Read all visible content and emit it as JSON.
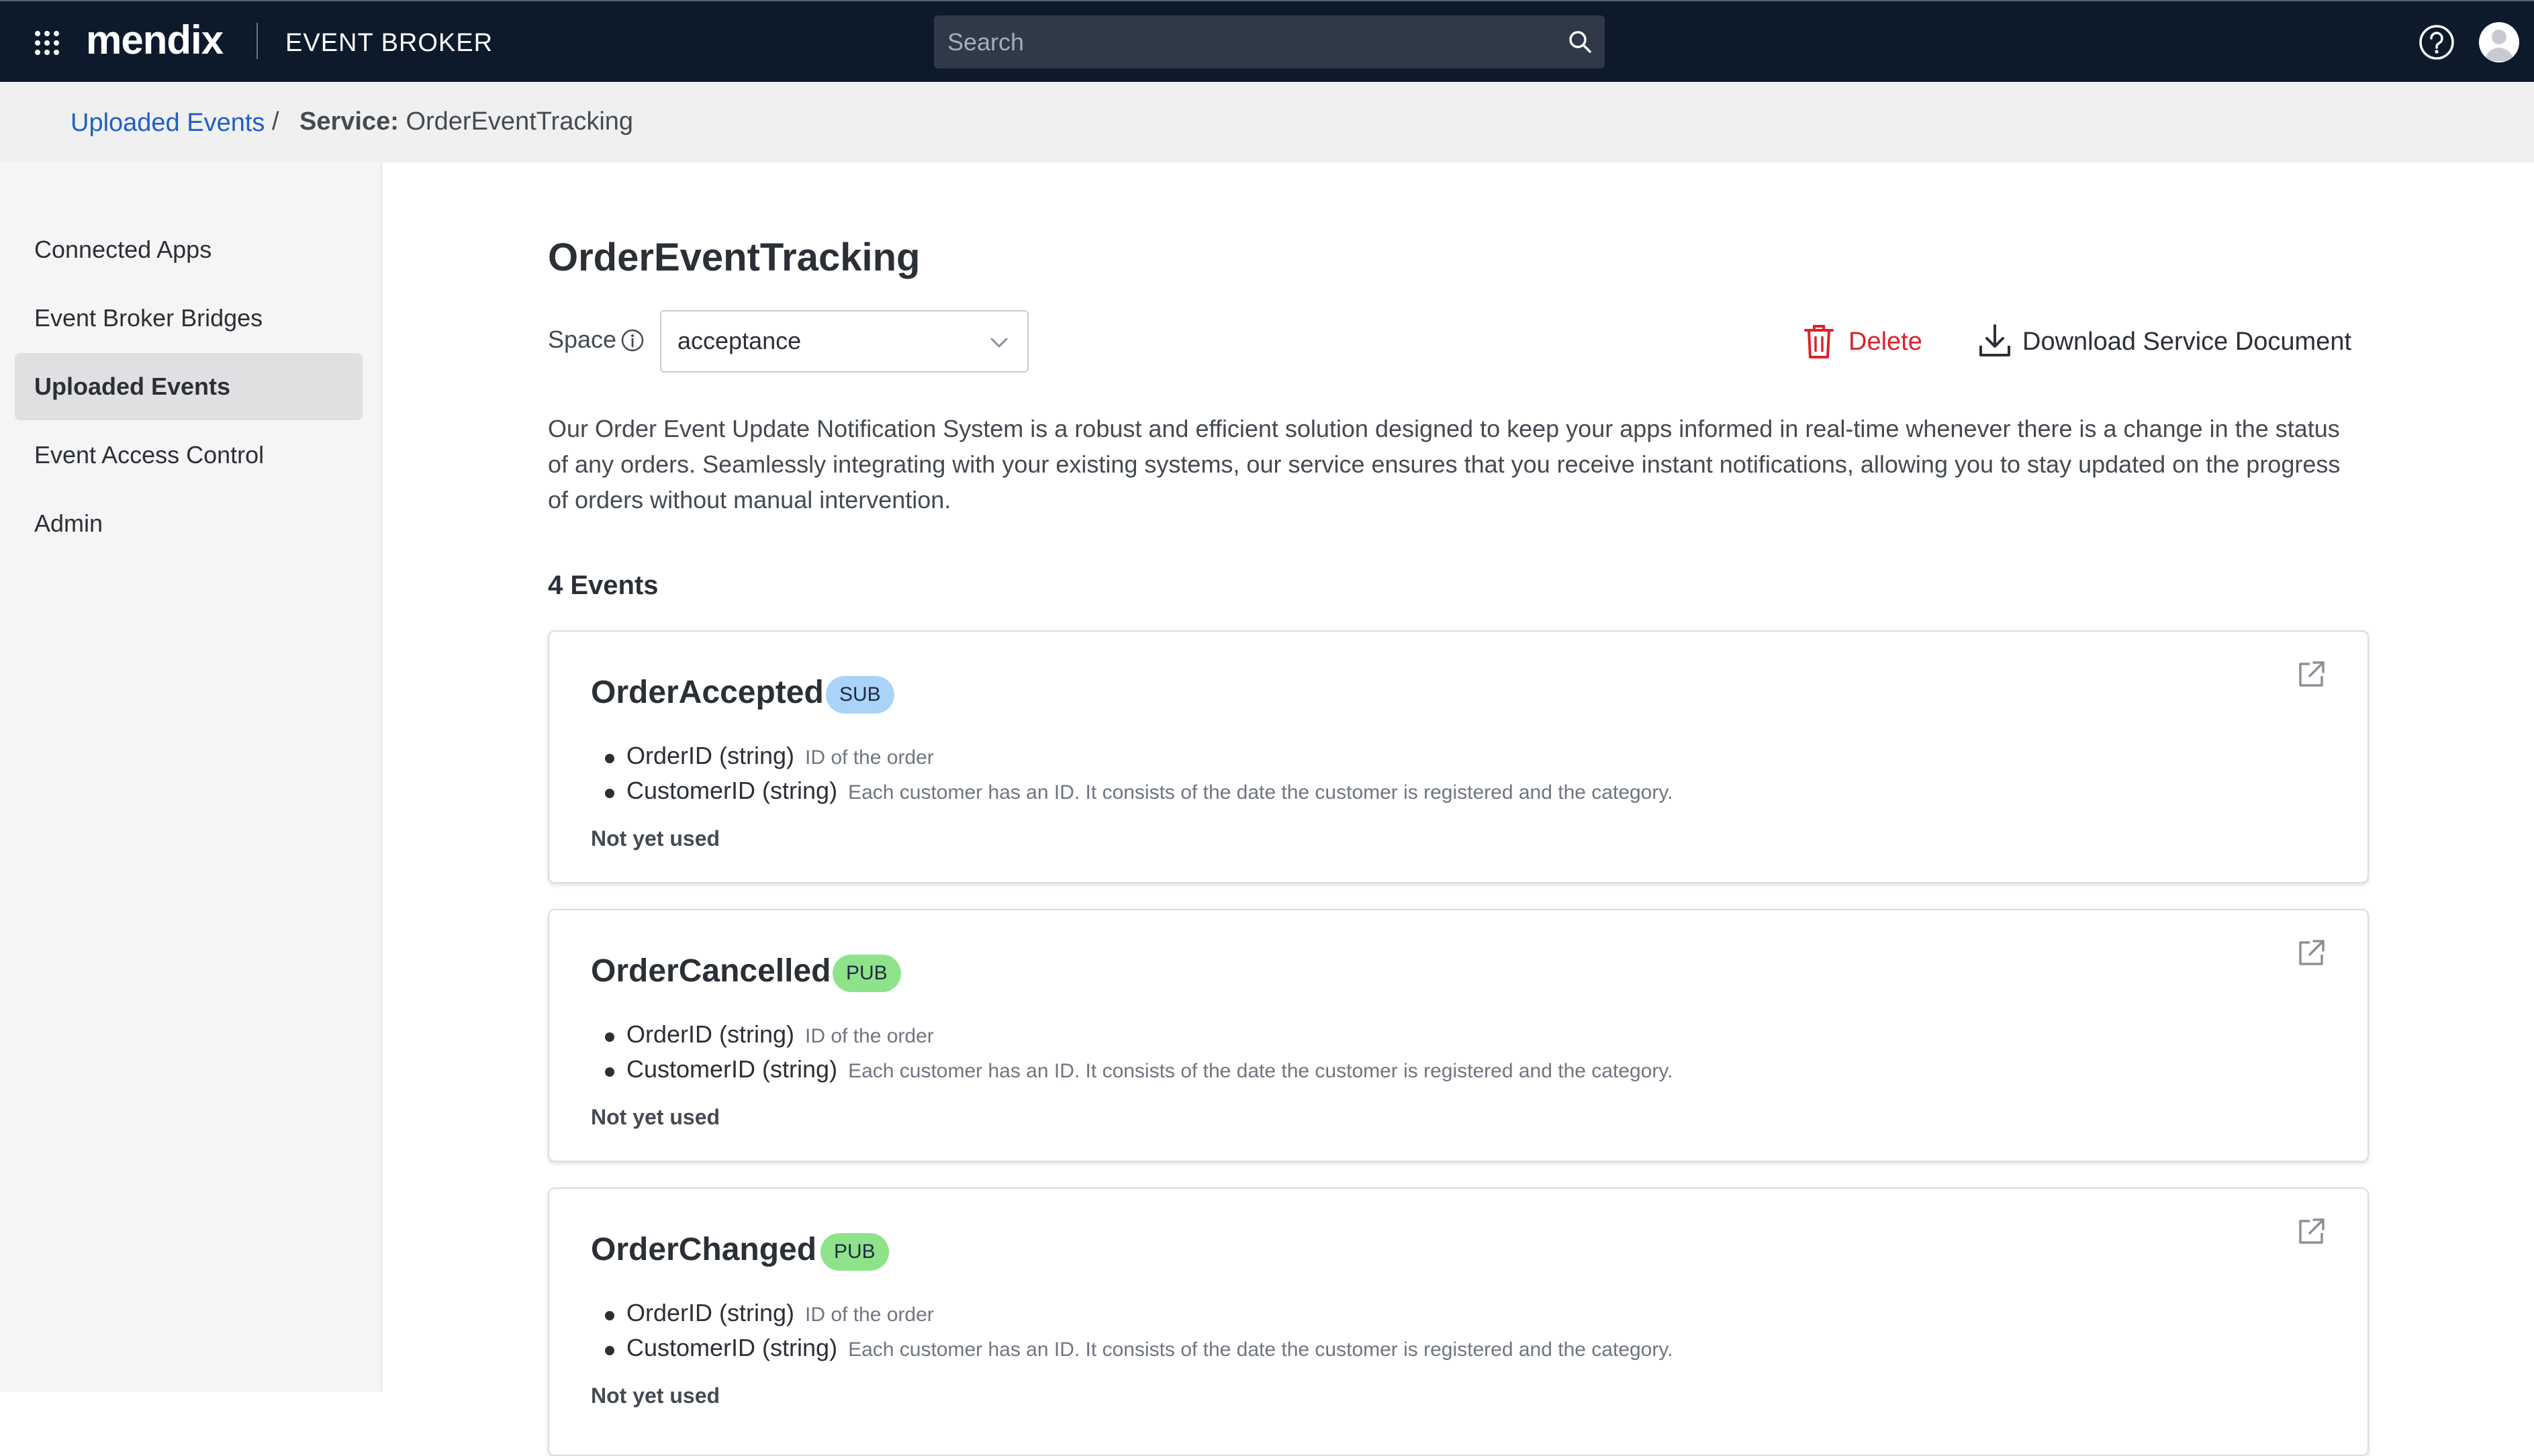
{
  "header": {
    "logo": "mendix",
    "product": "EVENT BROKER",
    "search_placeholder": "Search"
  },
  "breadcrumb": {
    "parent": "Uploaded Events",
    "separator": "/",
    "current_label": "Service:",
    "current_value": "OrderEventTracking"
  },
  "sidebar": {
    "items": [
      {
        "label": "Connected Apps",
        "active": false
      },
      {
        "label": "Event Broker Bridges",
        "active": false
      },
      {
        "label": "Uploaded Events",
        "active": true
      },
      {
        "label": "Event Access Control",
        "active": false
      },
      {
        "label": "Admin",
        "active": false
      }
    ]
  },
  "service": {
    "title": "OrderEventTracking",
    "space_label": "Space",
    "space_value": "acceptance",
    "delete_label": "Delete",
    "download_label": "Download Service Document",
    "description": "Our Order Event Update Notification System is a robust and efficient solution designed to keep your apps informed in real-time whenever there is a change in the status of any orders. Seamlessly integrating with your existing systems, our service ensures that you receive instant notifications, allowing you to stay updated on the progress of orders without manual intervention.",
    "events_count": "4 Events"
  },
  "events": [
    {
      "name": "OrderAccepted",
      "badge": "SUB",
      "fields": [
        {
          "name": "OrderID (string)",
          "desc": "ID of the order"
        },
        {
          "name": "CustomerID (string)",
          "desc": "Each customer has an ID. It consists of the date the customer is registered and the category."
        }
      ],
      "usage": "Not yet used"
    },
    {
      "name": "OrderCancelled",
      "badge": "PUB",
      "fields": [
        {
          "name": "OrderID (string)",
          "desc": "ID of the order"
        },
        {
          "name": "CustomerID (string)",
          "desc": "Each customer has an ID. It consists of the date the customer is registered and the category."
        }
      ],
      "usage": "Not yet used"
    },
    {
      "name": "OrderChanged",
      "badge": "PUB",
      "fields": [
        {
          "name": "OrderID (string)",
          "desc": "ID of the order"
        },
        {
          "name": "CustomerID (string)",
          "desc": "Each customer has an ID. It consists of the date the customer is registered and the category."
        }
      ],
      "usage": "Not yet used"
    }
  ],
  "colors": {
    "topbar": "#0d1a2b",
    "link": "#1f5fc8",
    "danger": "#d8242a",
    "sub_badge": "#a9d3f7",
    "pub_badge": "#8ee38a"
  },
  "icons": [
    "app-grid-icon",
    "search-icon",
    "help-icon",
    "avatar",
    "info-icon",
    "chevron-down-icon",
    "trash-icon",
    "download-icon",
    "external-link-icon"
  ]
}
